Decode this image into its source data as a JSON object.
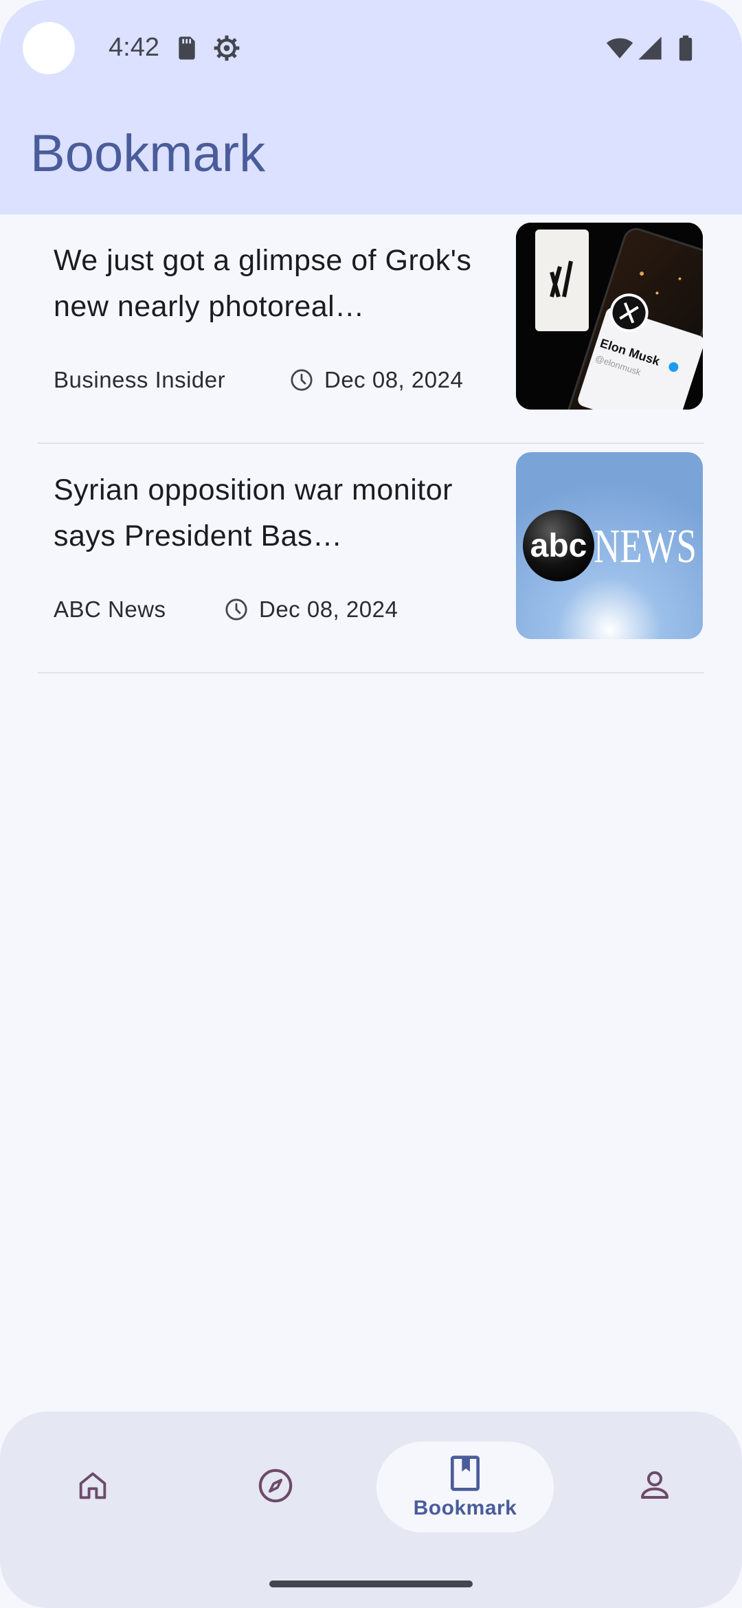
{
  "status_bar": {
    "time": "4:42",
    "icons_left": [
      "sd-card-icon",
      "settings-gear-icon"
    ],
    "icons_right": [
      "wifi-icon",
      "signal-icon",
      "battery-icon"
    ]
  },
  "header": {
    "title": "Bookmark"
  },
  "articles": [
    {
      "title": "We just got a glimpse of Grok's new nearly photoreal…",
      "source": "Business Insider",
      "date": "Dec 08, 2024",
      "thumbnail_caption": "Elon Musk",
      "thumbnail_handle": "@elonmusk"
    },
    {
      "title": "Syrian opposition war monitor says President Bas…",
      "source": "ABC News",
      "date": "Dec 08, 2024",
      "thumbnail_logo_left": "abc",
      "thumbnail_logo_right": "NEWS"
    }
  ],
  "bottom_nav": {
    "items": [
      {
        "name": "home",
        "icon": "home-icon",
        "label": ""
      },
      {
        "name": "explore",
        "icon": "compass-icon",
        "label": ""
      },
      {
        "name": "bookmark",
        "icon": "bookmark-icon",
        "label": "Bookmark",
        "selected": true
      },
      {
        "name": "profile",
        "icon": "person-icon",
        "label": ""
      }
    ]
  },
  "colors": {
    "header_bg": "#dbe1ff",
    "accent": "#4a5c9a",
    "page_bg": "#f6f7fd",
    "nav_bg": "#e5e7f3",
    "nav_icon": "#6d4a6b"
  }
}
